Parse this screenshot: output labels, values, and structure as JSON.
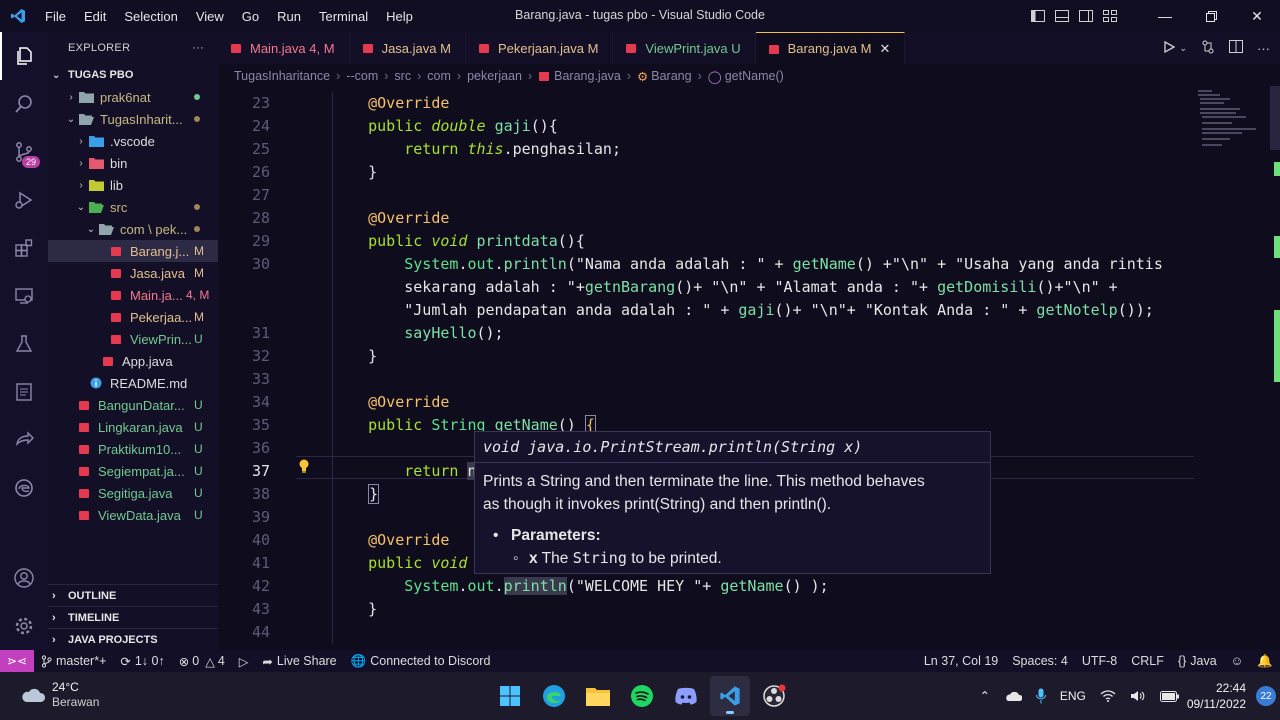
{
  "window": {
    "title": "Barang.java - tugas pbo - Visual Studio Code",
    "menu": [
      "File",
      "Edit",
      "Selection",
      "View",
      "Go",
      "Run",
      "Terminal",
      "Help"
    ]
  },
  "activity": {
    "scm_badge": "29"
  },
  "explorer": {
    "header": "EXPLORER",
    "more": "···",
    "workspace": "TUGAS PBO",
    "items": [
      {
        "label": "prak6nat",
        "status": ""
      },
      {
        "label": "TugasInharit...",
        "status": ""
      },
      {
        "label": ".vscode",
        "status": ""
      },
      {
        "label": "bin",
        "status": ""
      },
      {
        "label": "lib",
        "status": ""
      },
      {
        "label": "src",
        "status": ""
      },
      {
        "label": "com \\ pek...",
        "status": ""
      },
      {
        "label": "Barang.j...",
        "status": "M"
      },
      {
        "label": "Jasa.java",
        "status": "M"
      },
      {
        "label": "Main.ja...",
        "status": "4, M"
      },
      {
        "label": "Pekerjaa...",
        "status": "M"
      },
      {
        "label": "ViewPrin...",
        "status": "U"
      },
      {
        "label": "App.java",
        "status": ""
      },
      {
        "label": "README.md",
        "status": ""
      },
      {
        "label": "BangunDatar...",
        "status": "U"
      },
      {
        "label": "Lingkaran.java",
        "status": "U"
      },
      {
        "label": "Praktikum10...",
        "status": "U"
      },
      {
        "label": "Segiempat.ja...",
        "status": "U"
      },
      {
        "label": "Segitiga.java",
        "status": "U"
      },
      {
        "label": "ViewData.java",
        "status": "U"
      }
    ],
    "outline": "OUTLINE",
    "timeline": "TIMELINE",
    "java_projects": "JAVA PROJECTS"
  },
  "tabs": [
    {
      "name": "Main.java",
      "status": "4, M"
    },
    {
      "name": "Jasa.java",
      "status": "M"
    },
    {
      "name": "Pekerjaan.java",
      "status": "M"
    },
    {
      "name": "ViewPrint.java",
      "status": "U"
    },
    {
      "name": "Barang.java",
      "status": "M"
    }
  ],
  "breadcrumb": [
    "TugasInharitance",
    "--com",
    "src",
    "com",
    "pekerjaan",
    "Barang.java",
    "Barang",
    "getName()"
  ],
  "code": {
    "line_numbers": [
      "23",
      "24",
      "25",
      "26",
      "27",
      "28",
      "29",
      "30",
      "",
      "",
      "31",
      "32",
      "33",
      "34",
      "35",
      "36",
      "37",
      "38",
      "39",
      "40",
      "41",
      "42",
      "43",
      "44"
    ]
  },
  "hover": {
    "signature": "void java.io.PrintStream.println(String x)",
    "doc_line1": "Prints a String and then terminate the line. This method behaves",
    "doc_line2": "as though it invokes print(String) and then println().",
    "params_label": "Parameters:",
    "param_name": "x",
    "param_the": "The",
    "param_type": "String",
    "param_rest": "to be printed."
  },
  "statusbar": {
    "branch": "master*+",
    "sync": "1↓ 0↑",
    "errors": "0",
    "warnings": "4",
    "liveshare": "Live Share",
    "discord": "Connected to Discord",
    "position": "Ln 37, Col 19",
    "spaces": "Spaces: 4",
    "encoding": "UTF-8",
    "eol": "CRLF",
    "language": "Java"
  },
  "taskbar": {
    "temp": "24°C",
    "weather": "Berawan",
    "lang": "ENG",
    "time": "22:44",
    "date": "09/11/2022",
    "notifications": "22"
  },
  "colors": {
    "accent_tab_border": "#f7c04a",
    "remote": "#c23fbd",
    "modified": "#e2c08d",
    "untracked": "#73c991"
  }
}
